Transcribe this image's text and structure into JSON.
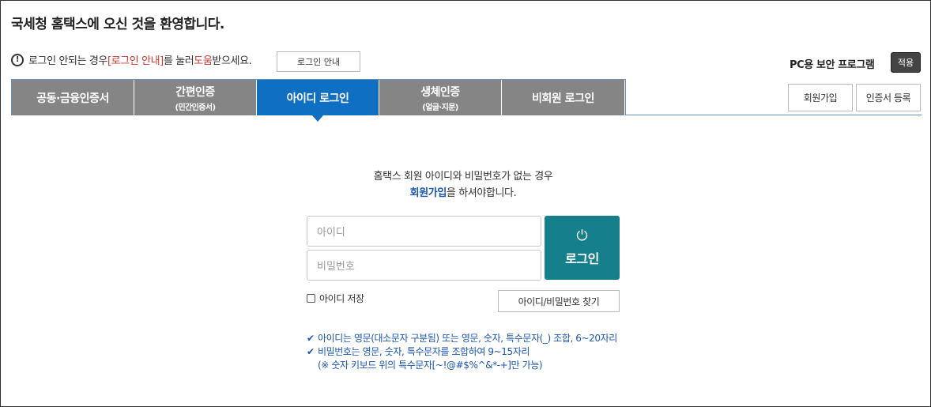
{
  "title": "국세청 홈택스에 오신 것을 환영합니다.",
  "notice": {
    "prefix": "로그인 안되는 경우 ",
    "link": "[로그인 안내]",
    "middle": "를 눌러 ",
    "help": "도움",
    "suffix": "받으세요.",
    "guide_button": "로그인 안내"
  },
  "security": {
    "label": "PC용 보안 프로그램",
    "apply_button": "적용"
  },
  "tabs": [
    {
      "label": "공동·금융인증서",
      "sub": ""
    },
    {
      "label": "간편인증",
      "sub": "(민간인증서)"
    },
    {
      "label": "아이디 로그인",
      "sub": ""
    },
    {
      "label": "생체인증",
      "sub": "(얼굴·지문)"
    },
    {
      "label": "비회원 로그인",
      "sub": ""
    }
  ],
  "active_tab_index": 2,
  "side_buttons": {
    "join": "회원가입",
    "cert_register": "인증서 등록"
  },
  "info": {
    "line1": "홈택스 회원 아이디와 비밀번호가 없는 경우",
    "join_link": "회원가입",
    "line2_suffix": "을 하셔야합니다."
  },
  "form": {
    "id_placeholder": "아이디",
    "pw_placeholder": "비밀번호",
    "login_label": "로그인",
    "save_id_label": "아이디 저장",
    "find_button": "아이디/비밀번호 찾기"
  },
  "rules": {
    "rule1": "아이디는 영문(대소문자 구분됨) 또는 영문, 숫자, 특수문자(_) 조합, 6~20자리",
    "rule2": "비밀번호는 영문, 숫자, 특수문자를 조합하여 9~15자리",
    "rule2_note": "(※ 숫자 키보드 위의 특수문자[~!@#$%^&*-+]만 가능)"
  },
  "colors": {
    "active_tab": "#0f6fc2",
    "inactive_tab": "#858585",
    "login_button": "#157f8b",
    "link_red": "#d0342c",
    "rule_blue": "#1a56b0"
  },
  "icons": {
    "warning": "exclamation-circle-icon",
    "power": "power-icon",
    "check": "checkmark-icon"
  }
}
